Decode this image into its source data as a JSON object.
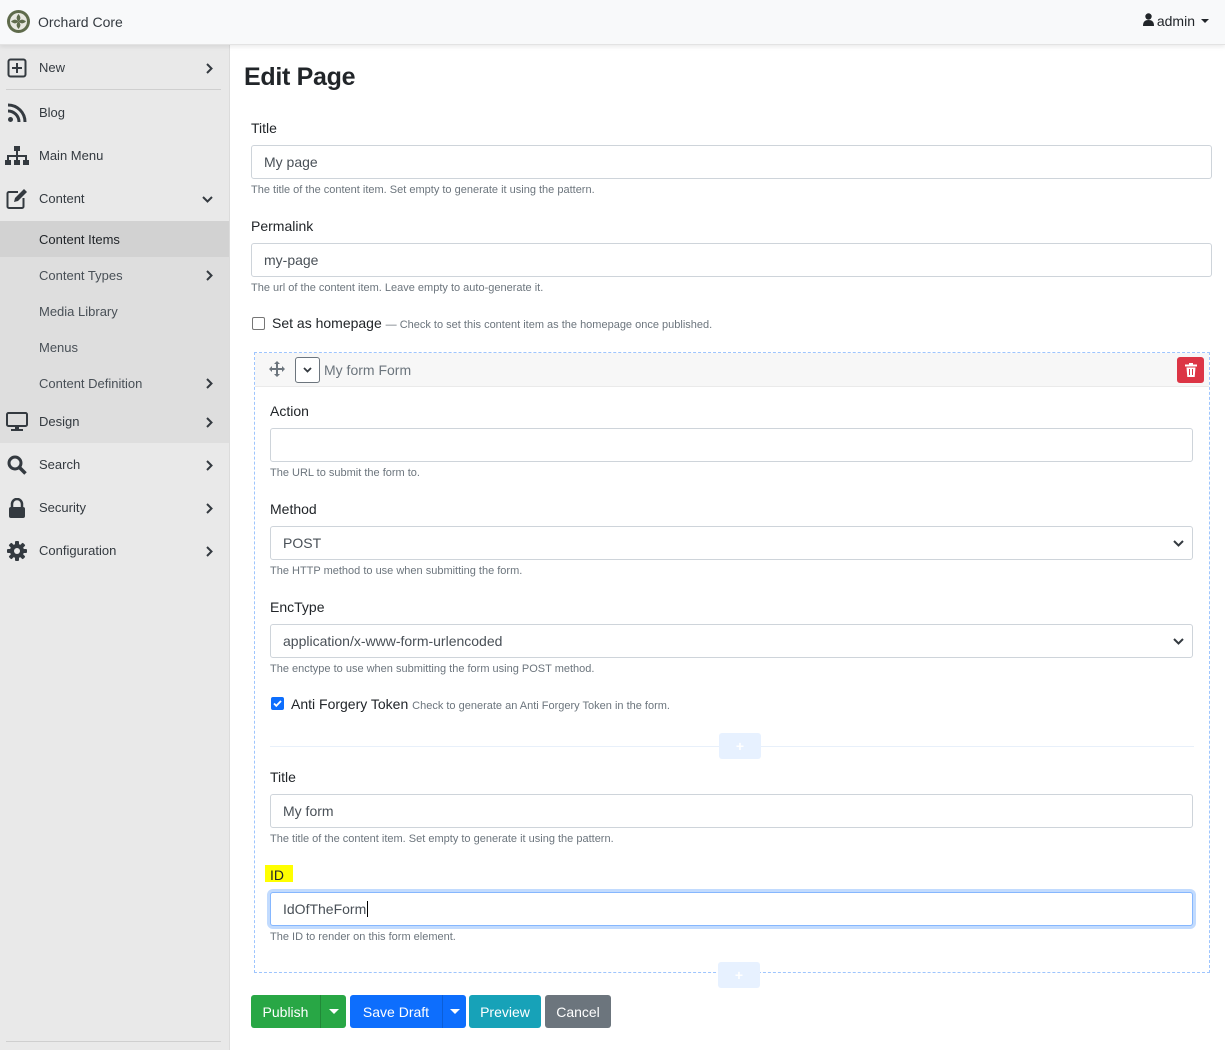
{
  "app": {
    "name": "Orchard Core",
    "user": "admin"
  },
  "sidebar": {
    "items": [
      {
        "label": "New",
        "icon": "plus-square-icon"
      },
      {
        "label": "Blog",
        "icon": "rss-icon"
      },
      {
        "label": "Main Menu",
        "icon": "sitemap-icon"
      },
      {
        "label": "Content",
        "icon": "edit-icon"
      },
      {
        "label": "Design",
        "icon": "desktop-icon"
      },
      {
        "label": "Search",
        "icon": "search-icon"
      },
      {
        "label": "Security",
        "icon": "lock-icon"
      },
      {
        "label": "Configuration",
        "icon": "gear-icon"
      }
    ],
    "content_children": [
      {
        "label": "Content Items",
        "active": true
      },
      {
        "label": "Content Types"
      },
      {
        "label": "Media Library"
      },
      {
        "label": "Menus"
      },
      {
        "label": "Content Definition"
      }
    ]
  },
  "page": {
    "heading": "Edit Page",
    "title_label": "Title",
    "title_value": "My page",
    "title_hint": "The title of the content item. Set empty to generate it using the pattern.",
    "permalink_label": "Permalink",
    "permalink_value": "my-page",
    "permalink_hint": "The url of the content item. Leave empty to auto-generate it.",
    "homepage_label": "Set as homepage",
    "homepage_hint": "— Check to set this content item as the homepage once published.",
    "homepage_checked": false
  },
  "form_widget": {
    "header_title": "My form Form",
    "action_label": "Action",
    "action_value": "",
    "action_hint": "The URL to submit the form to.",
    "method_label": "Method",
    "method_value": "POST",
    "method_hint": "The HTTP method to use when submitting the form.",
    "enctype_label": "EncType",
    "enctype_value": "application/x-www-form-urlencoded",
    "enctype_hint": "The enctype to use when submitting the form using POST method.",
    "antiforgery_label": "Anti Forgery Token",
    "antiforgery_hint": "Check to generate an Anti Forgery Token in the form.",
    "antiforgery_checked": true,
    "title_label": "Title",
    "title_value": "My form",
    "title_hint": "The title of the content item. Set empty to generate it using the pattern.",
    "id_label": "ID",
    "id_value": "IdOfTheForm",
    "id_hint": "The ID to render on this form element."
  },
  "actions": {
    "publish": "Publish",
    "save_draft": "Save Draft",
    "preview": "Preview",
    "cancel": "Cancel"
  },
  "colors": {
    "publish": "#28a745",
    "save_draft": "#0d6efd",
    "preview": "#17a2b8",
    "cancel": "#6c757d",
    "delete": "#dc3545",
    "highlight": "#ffff00"
  }
}
